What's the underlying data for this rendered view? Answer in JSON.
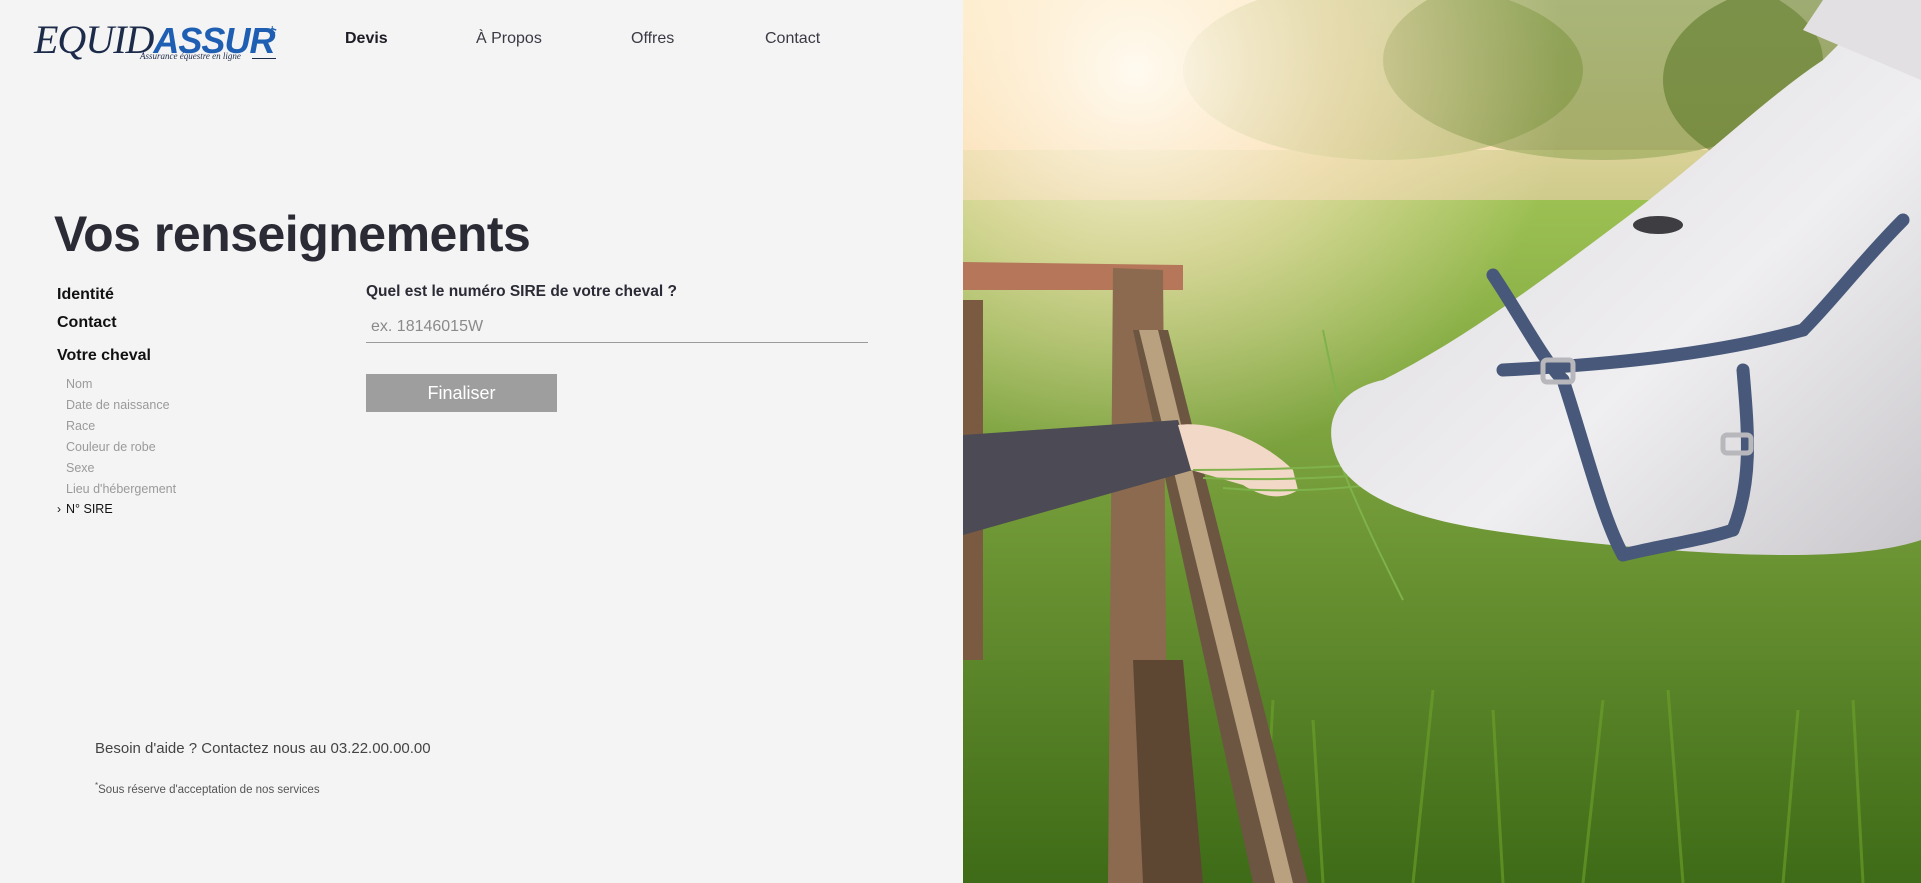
{
  "brand": {
    "logo_part1": "EQUID",
    "logo_part2": "ASSUR",
    "logo_suffix": ".fr",
    "tagline": "Assurance équestre en ligne"
  },
  "nav": {
    "items": [
      {
        "label": "Devis",
        "active": true
      },
      {
        "label": "À Propos",
        "active": false
      },
      {
        "label": "Offres",
        "active": false
      },
      {
        "label": "Contact",
        "active": false
      }
    ]
  },
  "page": {
    "title": "Vos renseignements"
  },
  "steps": {
    "main": [
      {
        "label": "Identité"
      },
      {
        "label": "Contact"
      },
      {
        "label": "Votre cheval"
      }
    ],
    "sub": [
      {
        "label": "Nom",
        "current": false
      },
      {
        "label": "Date de naissance",
        "current": false
      },
      {
        "label": "Race",
        "current": false
      },
      {
        "label": "Couleur de robe",
        "current": false
      },
      {
        "label": "Sexe",
        "current": false
      },
      {
        "label": "Lieu d'hébergement",
        "current": false
      },
      {
        "label": "N° SIRE",
        "current": true
      }
    ],
    "current_marker": "›"
  },
  "form": {
    "question": "Quel est le numéro SIRE de votre cheval ?",
    "sire_value": "",
    "sire_placeholder": "ex. 18146015W",
    "submit_label": "Finaliser"
  },
  "footer": {
    "help_text": "Besoin d'aide ? Contactez nous au 03.22.00.00.00",
    "note_marker": "*",
    "note_text": "Sous réserve d'acceptation de nos services"
  },
  "colors": {
    "background": "#f4f4f4",
    "brand_blue": "#1e5fb3",
    "brand_navy": "#1d2b4a",
    "button": "#9e9e9e"
  }
}
